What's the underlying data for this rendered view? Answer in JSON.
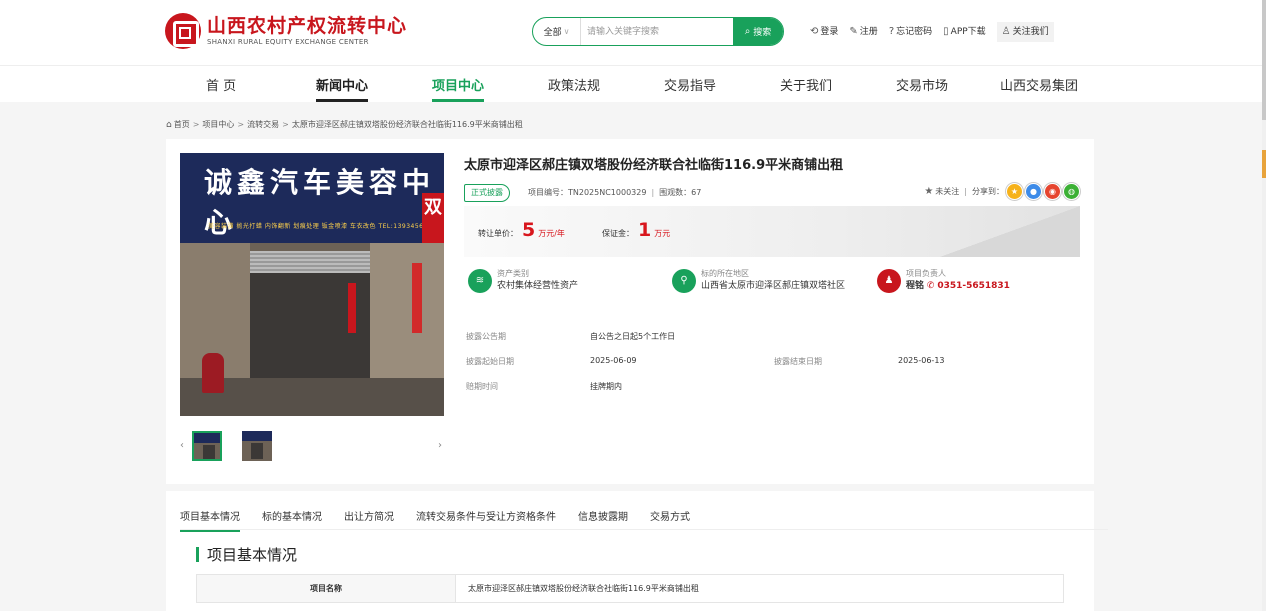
{
  "header": {
    "logo_cn": "山西农村产权流转中心",
    "logo_en": "SHANXI RURAL EQUITY EXCHANGE CENTER",
    "search": {
      "category": "全部",
      "placeholder": "请输入关键字搜索",
      "button": "搜索"
    },
    "links": [
      {
        "label": "登录",
        "icon": "login-icon"
      },
      {
        "label": "注册",
        "icon": "edit-icon"
      },
      {
        "label": "忘记密码",
        "icon": "question-icon"
      },
      {
        "label": "APP下载",
        "icon": "phone-icon"
      },
      {
        "label": "关注我们",
        "icon": "user-icon"
      }
    ]
  },
  "nav": {
    "items": [
      {
        "label": "首 页"
      },
      {
        "label": "新闻中心"
      },
      {
        "label": "项目中心"
      },
      {
        "label": "政策法规"
      },
      {
        "label": "交易指导"
      },
      {
        "label": "关于我们"
      },
      {
        "label": "交易市场"
      },
      {
        "label": "山西交易集团"
      }
    ],
    "active": "项目中心"
  },
  "breadcrumb": [
    "首页",
    "项目中心",
    "流转交易",
    "太原市迎泽区郝庄镇双塔股份经济联合社临街116.9平米商铺出租"
  ],
  "project": {
    "photo": {
      "sign": "诚鑫汽车美容中心",
      "sub": "美容装潢  抛光打蜡  内饰翻新  划痕处理  钣金喷漆  车衣改色  TEL:1393456764",
      "side": "双"
    },
    "title": "太原市迎泽区郝庄镇双塔股份经济联合社临街116.9平米商铺出租",
    "badge": "正式披露",
    "code_label": "项目编号：",
    "code": "TN2025NC1000329",
    "views_label": "围观数：",
    "views": "67",
    "follow": "未关注",
    "share_label": "分享到：",
    "price": {
      "label": "转让单价：",
      "value": "5",
      "unit": "万元/年"
    },
    "deposit": {
      "label": "保证金：",
      "value": "1",
      "unit": "万元"
    },
    "info": [
      {
        "label": "资产类别",
        "value": "农村集体经营性资产",
        "color": "#19a15b"
      },
      {
        "label": "标的所在地区",
        "value": "山西省太原市迎泽区郝庄镇双塔社区",
        "color": "#19a15b"
      },
      {
        "label": "项目负责人",
        "person": "程铭",
        "phone": "0351-5651831",
        "color": "#c8161d"
      }
    ],
    "details": {
      "period_label": "披露公告期",
      "period_value": "自公告之日起5个工作日",
      "start_label": "披露起始日期",
      "start_value": "2025-06-09",
      "end_label": "披露结束日期",
      "end_value": "2025-06-13",
      "bid_label": "赔期时间",
      "bid_value": "挂牌期内"
    }
  },
  "tabs": {
    "items": [
      "项目基本情况",
      "标的基本情况",
      "出让方简况",
      "流转交易条件与受让方资格条件",
      "信息披露期",
      "交易方式"
    ],
    "active": "项目基本情况"
  },
  "section": {
    "title": "项目基本情况",
    "rows": [
      {
        "key": "项目名称",
        "value": "太原市迎泽区郝庄镇双塔股份经济联合社临街116.9平米商铺出租"
      }
    ]
  }
}
